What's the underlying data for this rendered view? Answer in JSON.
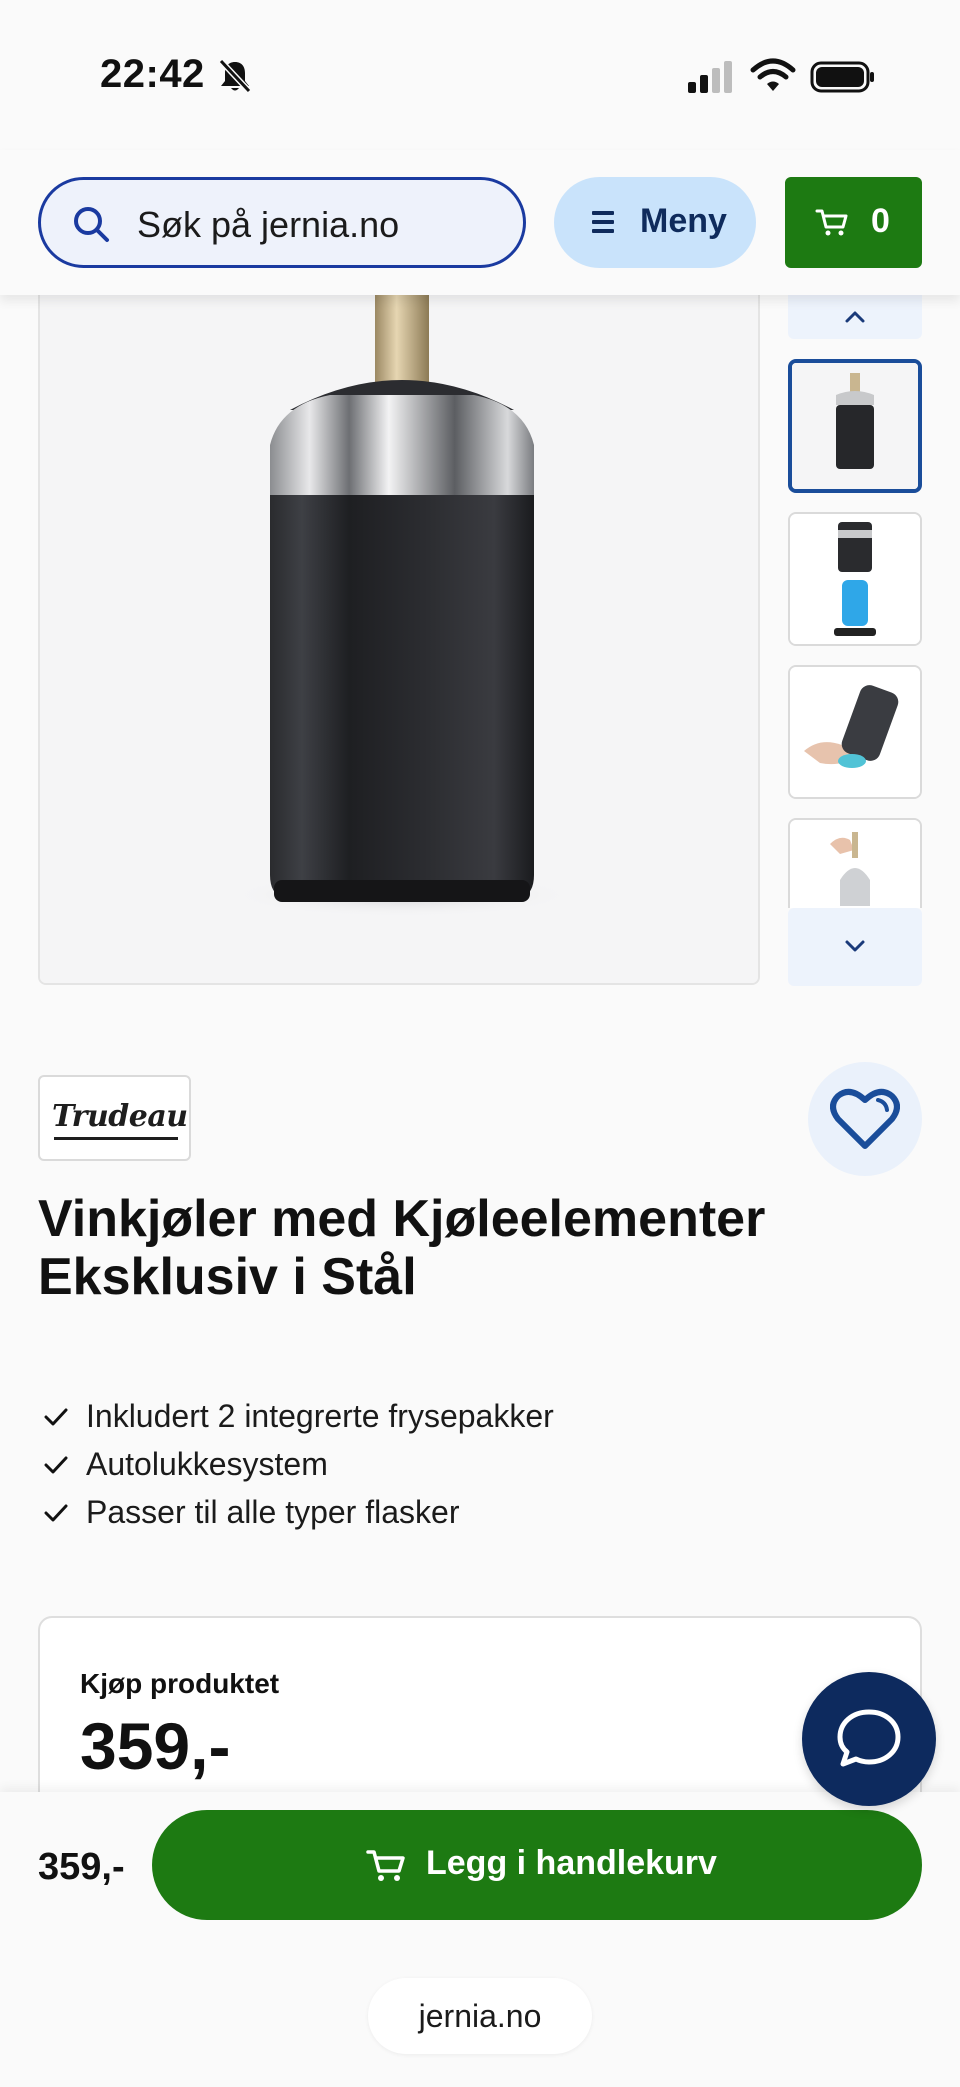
{
  "status_bar": {
    "time": "22:42",
    "icons": [
      "bell-slash-icon",
      "signal-icon",
      "wifi-icon",
      "battery-icon"
    ]
  },
  "header": {
    "search_placeholder": "Søk på jernia.no",
    "menu_label": "Meny",
    "cart_count": "0"
  },
  "gallery": {
    "thumbnail_count": 4,
    "active_thumbnail": 1
  },
  "product": {
    "brand": "Trudeau",
    "title": "Vinkjøler med Kjøleelementer Eksklusiv i Stål",
    "features": [
      "Inkludert 2 integrerte frysepakker",
      "Autolukkesystem",
      "Passer til alle typer flasker"
    ]
  },
  "buy_box": {
    "label": "Kjøp produktet",
    "price": "359,-"
  },
  "bottom_bar": {
    "price": "359,-",
    "add_to_cart_label": "Legg i handlekurv"
  },
  "browser": {
    "url": "jernia.no"
  },
  "colors": {
    "primary_green": "#1d7a12",
    "navy": "#0d2a5e",
    "search_border": "#1a3aa0",
    "menu_bg": "#c9e3fb"
  }
}
